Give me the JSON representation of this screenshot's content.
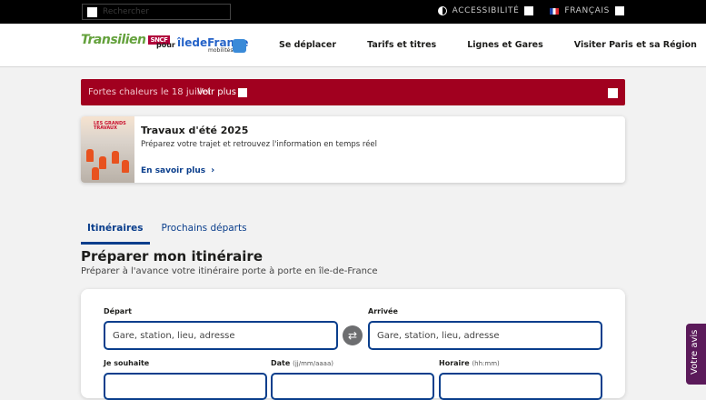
{
  "topbar": {
    "search_placeholder": "Rechercher",
    "accessibility_label": "ACCESSIBILITÉ",
    "language_label": "FRANÇAIS"
  },
  "header": {
    "brand": "Transilien",
    "brand_badge": "SNCF",
    "pour": "pour",
    "partner": "îledeFrance",
    "partner_sub": "mobilités",
    "nav": [
      "Se déplacer",
      "Tarifs et titres",
      "Lignes et Gares",
      "Visiter Paris et sa Région"
    ]
  },
  "alert": {
    "text": "Fortes chaleurs le 18 juillet",
    "more": "Voir plus",
    "color": "#a1001f"
  },
  "promo": {
    "badge": "LES GRANDS TRAVAUX",
    "title": "Travaux d'été 2025",
    "description": "Préparez votre trajet et retrouvez l'information en temps réel",
    "link": "En savoir plus"
  },
  "tabs": [
    {
      "label": "Itinéraires",
      "active": true
    },
    {
      "label": "Prochains départs",
      "active": false
    }
  ],
  "planner": {
    "title": "Préparer mon itinéraire",
    "subtitle": "Préparer à l'avance votre itinéraire porte à porte en île-de-France",
    "depart_label": "Départ",
    "depart_placeholder": "Gare, station, lieu, adresse",
    "arrivee_label": "Arrivée",
    "arrivee_placeholder": "Gare, station, lieu, adresse",
    "souhaite_label": "Je souhaite",
    "date_label": "Date",
    "date_hint": "(jj/mm/aaaa)",
    "horaire_label": "Horaire",
    "horaire_hint": "(hh:mm)"
  },
  "feedback": "Votre avis",
  "colors": {
    "brand_blue": "#0a3e8c",
    "transilien_green": "#64a13c",
    "feedback_purple": "#5b1a5a"
  }
}
